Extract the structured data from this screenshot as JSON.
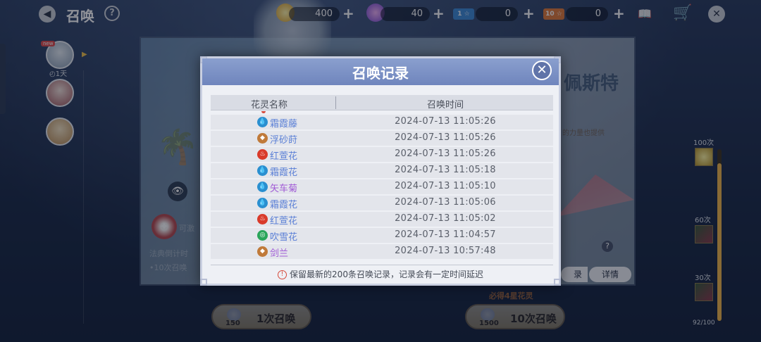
{
  "header": {
    "title": "召唤",
    "back_icon": "back-arrow-icon",
    "help_label": "?",
    "close_label": "✕"
  },
  "resources": [
    {
      "name": "gem",
      "value": "400",
      "plus": "+"
    },
    {
      "name": "crystal",
      "value": "40",
      "plus": "+"
    },
    {
      "name": "ticket-blue",
      "value": "0",
      "plus": "+",
      "tag": "1 ☆"
    },
    {
      "name": "ticket-orange",
      "value": "0",
      "plus": "+",
      "tag": "10 ☆"
    }
  ],
  "sidebar": {
    "avatar_tag": "new",
    "avatar_days": "◴1天"
  },
  "banner": {
    "title_partial": "佩斯特",
    "sub_partial": "的力量也提供",
    "left_text1": "可激",
    "left_text2": "法典倒计时",
    "left_text3": "•10次召唤"
  },
  "progress": {
    "milestones": [
      "100次",
      "60次",
      "30次"
    ],
    "count": "92/100",
    "fraction": 0.92
  },
  "bottom": {
    "single": {
      "label": "1次召唤",
      "cost": "150"
    },
    "ten": {
      "label": "10次召唤",
      "cost": "1500"
    },
    "guarantee": "必得4星花灵",
    "record_tab": "录",
    "details": "详情"
  },
  "modal": {
    "title": "召唤记录",
    "close": "✕",
    "columns": {
      "name": "花灵名称",
      "time": "召唤时间"
    },
    "rows": [
      {
        "name": "霜霞藤",
        "time": "2024-07-13 11:05:26",
        "element": "water",
        "color": "#5a7fd6"
      },
      {
        "name": "浮砂莳",
        "time": "2024-07-13 11:05:26",
        "element": "earth",
        "color": "#5a7fd6"
      },
      {
        "name": "红萱花",
        "time": "2024-07-13 11:05:26",
        "element": "fire",
        "color": "#5a7fd6"
      },
      {
        "name": "霜霞花",
        "time": "2024-07-13 11:05:18",
        "element": "water",
        "color": "#5a7fd6"
      },
      {
        "name": "矢车菊",
        "time": "2024-07-13 11:05:10",
        "element": "water",
        "color": "#a05ad6"
      },
      {
        "name": "霜霞花",
        "time": "2024-07-13 11:05:06",
        "element": "water",
        "color": "#5a7fd6"
      },
      {
        "name": "红萱花",
        "time": "2024-07-13 11:05:02",
        "element": "fire",
        "color": "#5a7fd6"
      },
      {
        "name": "吹雪花",
        "time": "2024-07-13 11:04:57",
        "element": "wind",
        "color": "#5a7fd6"
      },
      {
        "name": "剑兰",
        "time": "2024-07-13 10:57:48",
        "element": "earth",
        "color": "#a05ad6"
      }
    ],
    "footer": "保留最新的200条召唤记录，记录会有一定时间延迟",
    "footer_icon": "!"
  },
  "element_colors": {
    "water": "#2a8fd0",
    "earth": "#c07a3a",
    "fire": "#d93a2a",
    "wind": "#2aa55a"
  },
  "element_glyphs": {
    "water": "💧",
    "earth": "◆",
    "fire": "♨",
    "wind": "◎"
  }
}
